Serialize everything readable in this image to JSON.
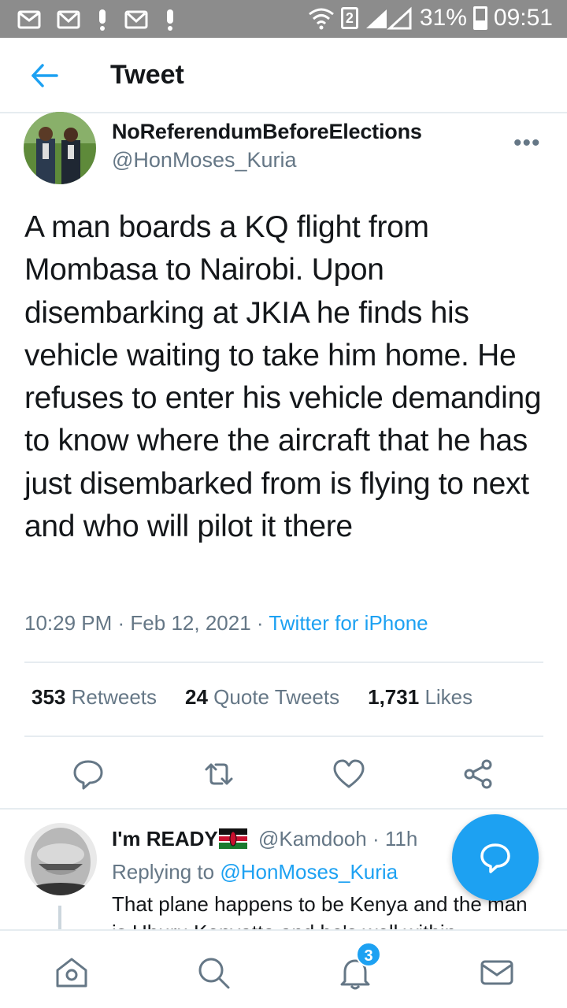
{
  "status_bar": {
    "sim_slot": "2",
    "battery": "31%",
    "time": "09:51"
  },
  "header": {
    "title": "Tweet"
  },
  "tweet": {
    "display_name": "NoReferendumBeforeElections",
    "handle": "@HonMoses_Kuria",
    "more": "•••",
    "text": "A man boards a KQ flight from Mombasa to Nairobi. Upon disembarking at JKIA he finds his vehicle waiting to take him home. He refuses to enter his vehicle demanding to know where the aircraft that he has just disembarked from is flying to next and who will pilot it there",
    "time": "10:29 PM",
    "date": "Feb 12, 2021",
    "source": "Twitter for iPhone",
    "retweets_count": "353",
    "retweets_label": "Retweets",
    "quotes_count": "24",
    "quotes_label": "Quote Tweets",
    "likes_count": "1,731",
    "likes_label": "Likes"
  },
  "reply": {
    "display_name": "I'm READY",
    "handle": "@Kamdooh",
    "age": "11h",
    "replying_prefix": "Replying to",
    "replying_to": "@HonMoses_Kuria",
    "text": "That plane happens to be Kenya and the man is Uhuru Kenyatta and he's well within"
  },
  "bottom_nav": {
    "notifications_badge": "3"
  },
  "colors": {
    "accent": "#1da1f2",
    "secondary_text": "#657786",
    "status_bar": "#8c8c8c"
  },
  "icons": [
    "email-icon",
    "gmail-icon",
    "alert-icon",
    "wifi-icon",
    "signal-icon",
    "battery-icon",
    "back-arrow-icon",
    "more-icon",
    "reply-icon",
    "retweet-icon",
    "like-icon",
    "share-icon",
    "compose-icon",
    "home-icon",
    "search-icon",
    "bell-icon",
    "messages-icon"
  ]
}
